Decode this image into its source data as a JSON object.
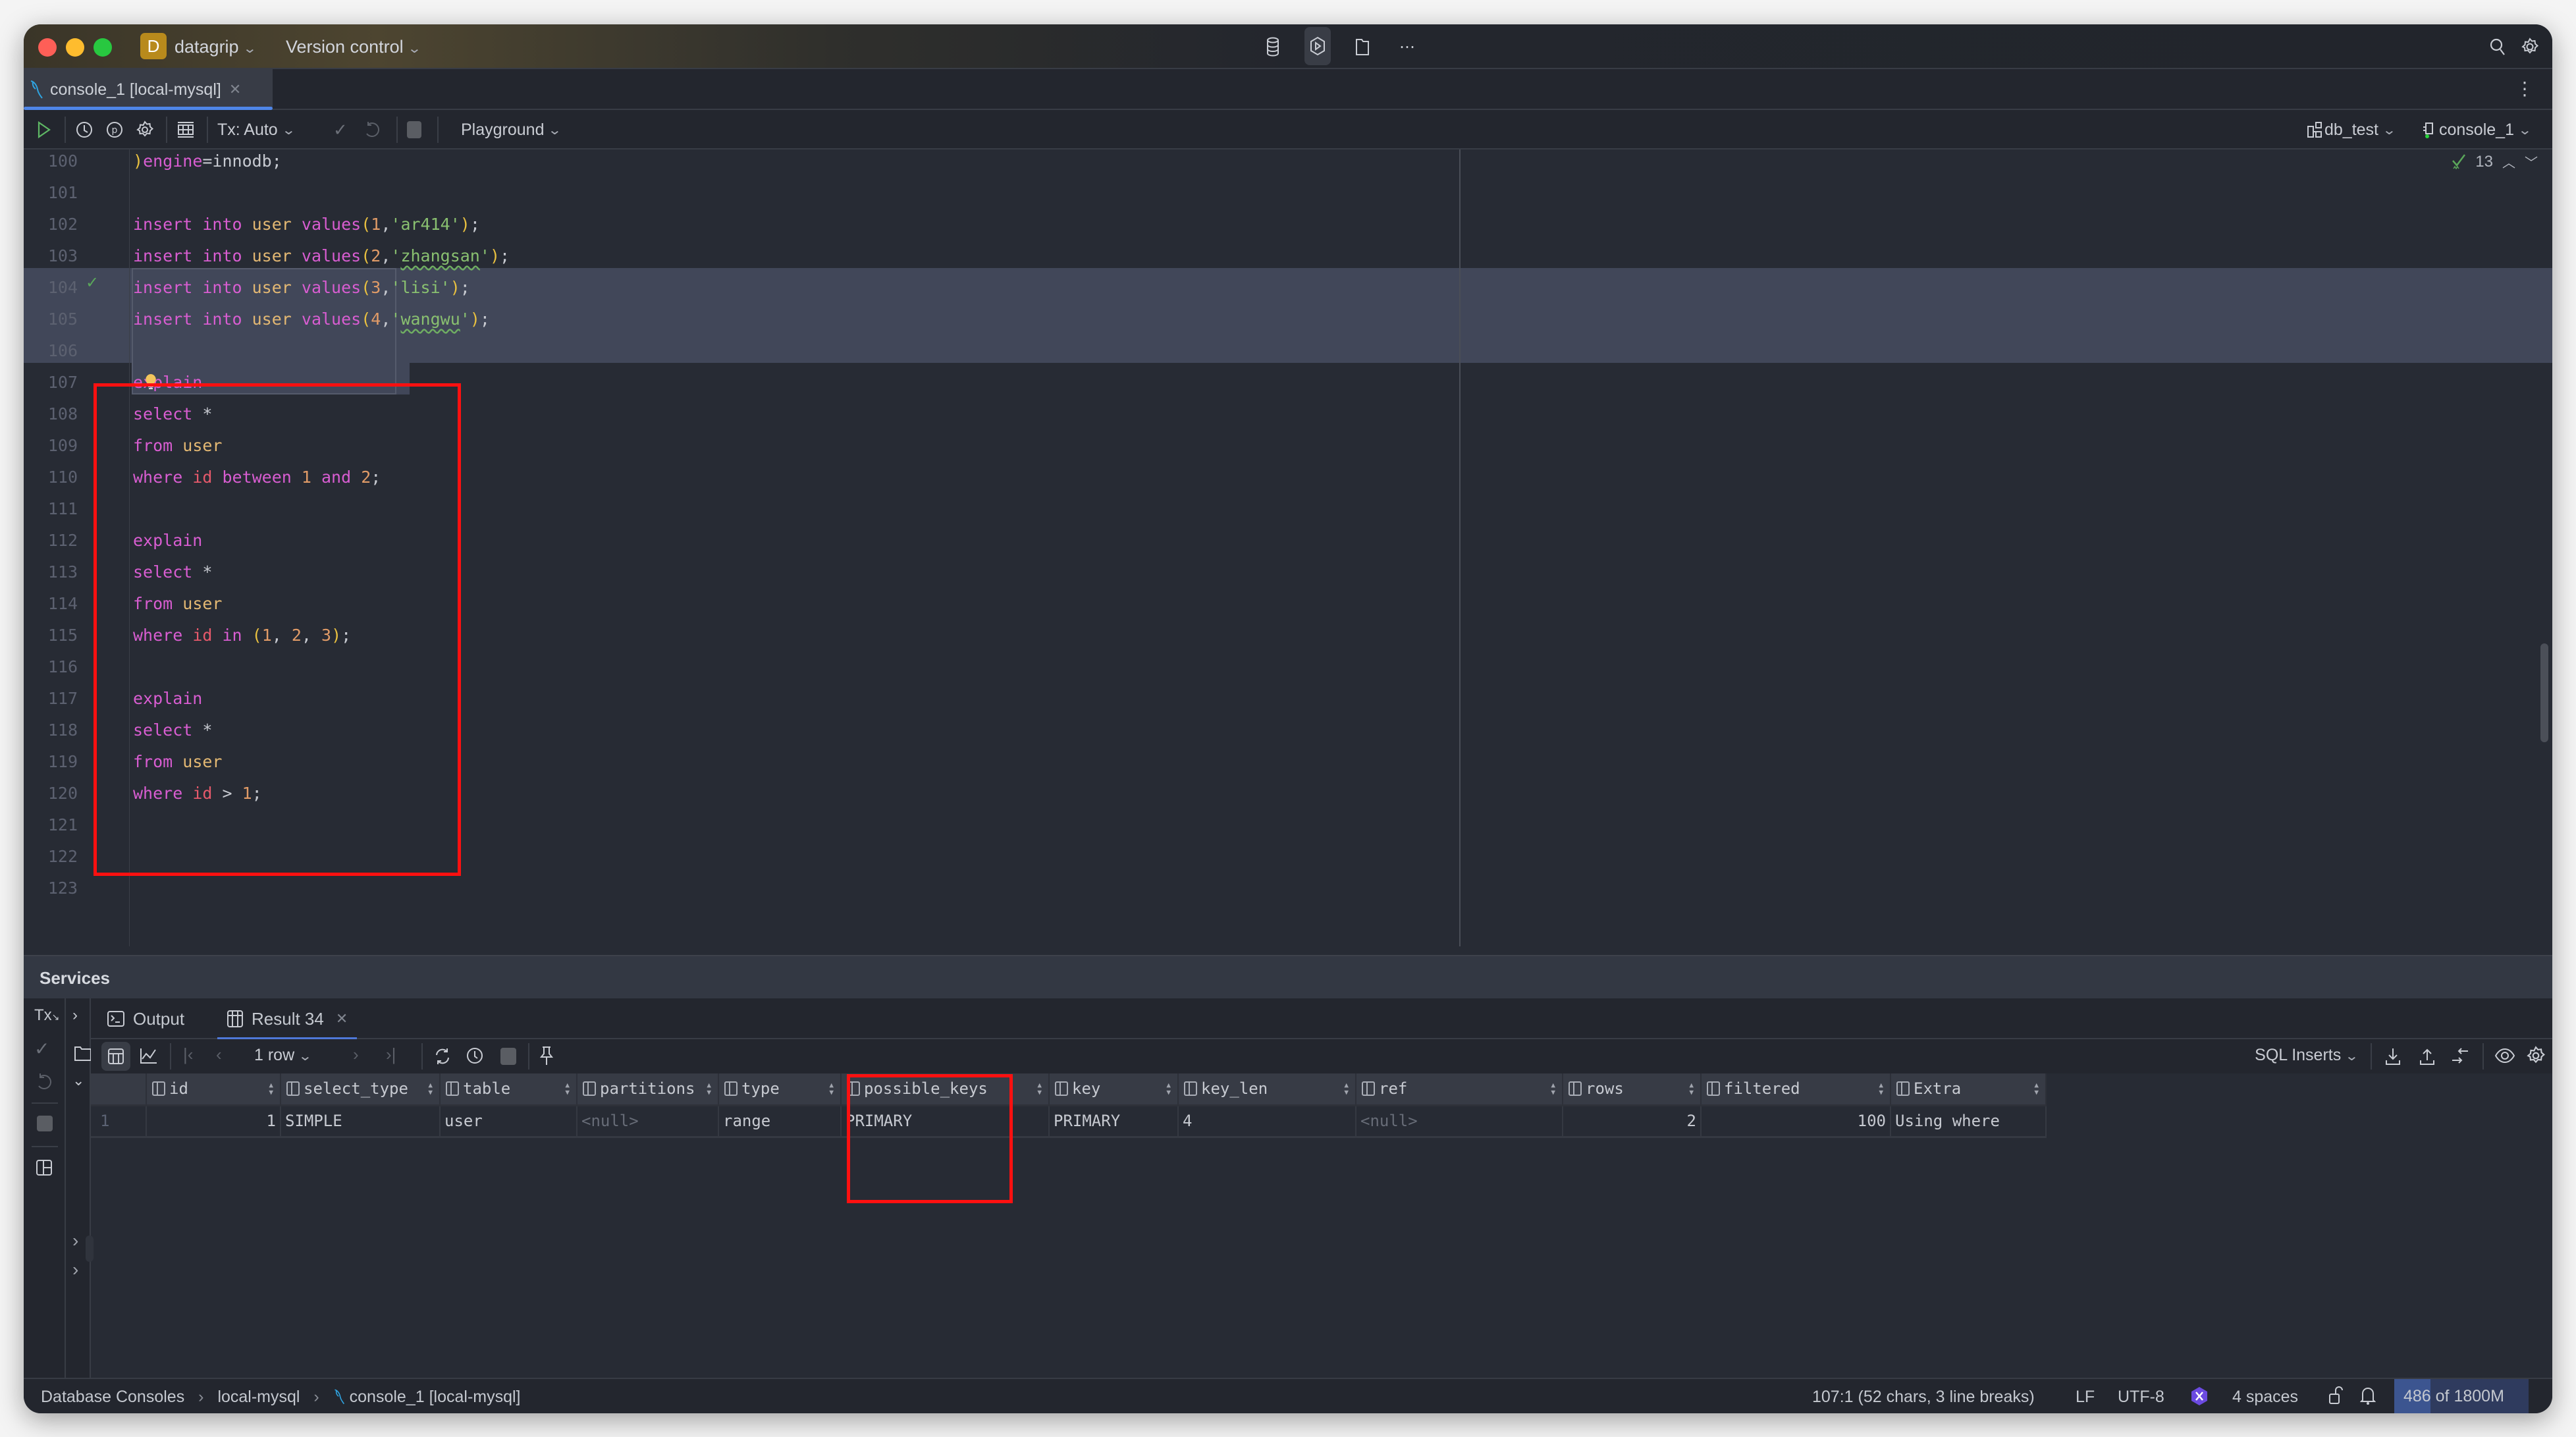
{
  "titlebar": {
    "project_badge": "D",
    "project_name": "datagrip",
    "vcs_label": "Version control",
    "center_icons": [
      "database-icon",
      "services-icon",
      "folder-icon",
      "more-icon"
    ],
    "right_icons": [
      "search-icon",
      "settings-icon"
    ]
  },
  "editor_tab": {
    "label": "console_1 [local-mysql]",
    "icon": "mysql-dolphin-icon"
  },
  "toolbar": {
    "tx_mode": "Tx: Auto",
    "playground": "Playground",
    "datasource": "db_test",
    "session": "console_1"
  },
  "editor": {
    "inspections_count": "13",
    "lines": [
      {
        "n": "100",
        "tokens": [
          [
            "paren",
            ")"
          ],
          [
            "kw",
            "engine"
          ],
          [
            "op",
            "=innodb;"
          ]
        ]
      },
      {
        "n": "101",
        "tokens": []
      },
      {
        "n": "102",
        "tokens": [
          [
            "kw",
            "insert into "
          ],
          [
            "tbl",
            "user "
          ],
          [
            "kw",
            "values"
          ],
          [
            "paren",
            "("
          ],
          [
            "num",
            "1"
          ],
          [
            "op",
            ","
          ],
          [
            "str",
            "'ar414'"
          ],
          [
            "paren",
            ")"
          ],
          [
            "op",
            ";"
          ]
        ]
      },
      {
        "n": "103",
        "tokens": [
          [
            "kw",
            "insert into "
          ],
          [
            "tbl",
            "user "
          ],
          [
            "kw",
            "values"
          ],
          [
            "paren",
            "("
          ],
          [
            "num",
            "2"
          ],
          [
            "op",
            ","
          ],
          [
            "str",
            "'"
          ],
          [
            "str squig",
            "zhangsan"
          ],
          [
            "str",
            "'"
          ],
          [
            "paren",
            ")"
          ],
          [
            "op",
            ";"
          ]
        ]
      },
      {
        "n": "104",
        "tokens": [
          [
            "kw",
            "insert into "
          ],
          [
            "tbl",
            "user "
          ],
          [
            "kw",
            "values"
          ],
          [
            "paren",
            "("
          ],
          [
            "num",
            "3"
          ],
          [
            "op",
            ","
          ],
          [
            "str",
            "'lisi'"
          ],
          [
            "paren",
            ")"
          ],
          [
            "op",
            ";"
          ]
        ]
      },
      {
        "n": "105",
        "tokens": [
          [
            "kw",
            "insert into "
          ],
          [
            "tbl",
            "user "
          ],
          [
            "kw",
            "values"
          ],
          [
            "paren",
            "("
          ],
          [
            "num",
            "4"
          ],
          [
            "op",
            ","
          ],
          [
            "str",
            "'"
          ],
          [
            "str squig",
            "wangwu"
          ],
          [
            "str",
            "'"
          ],
          [
            "paren",
            ")"
          ],
          [
            "op",
            ";"
          ]
        ]
      },
      {
        "n": "106",
        "tokens": []
      },
      {
        "n": "107",
        "tokens": [
          [
            "kw",
            "explain"
          ]
        ]
      },
      {
        "n": "108",
        "tokens": [
          [
            "kw",
            "select "
          ],
          [
            "op",
            "*"
          ]
        ]
      },
      {
        "n": "109",
        "tokens": [
          [
            "kw",
            "from "
          ],
          [
            "tbl",
            "user"
          ]
        ]
      },
      {
        "n": "110",
        "tokens": [
          [
            "kw",
            "where "
          ],
          [
            "idf",
            "id "
          ],
          [
            "kw",
            "between "
          ],
          [
            "num",
            "1 "
          ],
          [
            "kw",
            "and "
          ],
          [
            "num",
            "2"
          ],
          [
            "op",
            ";"
          ]
        ]
      },
      {
        "n": "111",
        "tokens": []
      },
      {
        "n": "112",
        "tokens": [
          [
            "kw",
            "explain"
          ]
        ]
      },
      {
        "n": "113",
        "tokens": [
          [
            "kw",
            "select "
          ],
          [
            "op",
            "*"
          ]
        ]
      },
      {
        "n": "114",
        "tokens": [
          [
            "kw",
            "from "
          ],
          [
            "tbl",
            "user"
          ]
        ]
      },
      {
        "n": "115",
        "tokens": [
          [
            "kw",
            "where "
          ],
          [
            "idf",
            "id "
          ],
          [
            "kw",
            "in "
          ],
          [
            "paren",
            "("
          ],
          [
            "num",
            "1"
          ],
          [
            "op",
            ", "
          ],
          [
            "num",
            "2"
          ],
          [
            "op",
            ", "
          ],
          [
            "num",
            "3"
          ],
          [
            "paren",
            ")"
          ],
          [
            "op",
            ";"
          ]
        ]
      },
      {
        "n": "116",
        "tokens": []
      },
      {
        "n": "117",
        "tokens": [
          [
            "kw",
            "explain"
          ]
        ]
      },
      {
        "n": "118",
        "tokens": [
          [
            "kw",
            "select "
          ],
          [
            "op",
            "*"
          ]
        ]
      },
      {
        "n": "119",
        "tokens": [
          [
            "kw",
            "from "
          ],
          [
            "tbl",
            "user"
          ]
        ]
      },
      {
        "n": "120",
        "tokens": [
          [
            "kw",
            "where "
          ],
          [
            "idf",
            "id "
          ],
          [
            "op",
            "> "
          ],
          [
            "num",
            "1"
          ],
          [
            "op",
            ";"
          ]
        ]
      },
      {
        "n": "121",
        "tokens": []
      },
      {
        "n": "122",
        "tokens": []
      },
      {
        "n": "123",
        "tokens": []
      }
    ]
  },
  "services": {
    "title": "Services",
    "tx_label": "Tx",
    "tabs": [
      {
        "label": "Output",
        "active": false
      },
      {
        "label": "Result 34",
        "active": true
      }
    ],
    "row_count": "1 row",
    "export_format": "SQL Inserts",
    "columns": [
      "id",
      "select_type",
      "table",
      "partitions",
      "type",
      "possible_keys",
      "key",
      "key_len",
      "ref",
      "rows",
      "filtered",
      "Extra"
    ],
    "rows": [
      {
        "row_number": "1",
        "cells": [
          "1",
          "SIMPLE",
          "user",
          "<null>",
          "range",
          "PRIMARY",
          "PRIMARY",
          "4",
          "<null>",
          "2",
          "100",
          "Using where"
        ]
      }
    ]
  },
  "statusbar": {
    "breadcrumb": [
      "Database Consoles",
      "local-mysql",
      "console_1 [local-mysql]"
    ],
    "caret": "107:1 (52 chars, 3 line breaks)",
    "line_ending": "LF",
    "encoding": "UTF-8",
    "indent": "4 spaces",
    "memory": "486 of 1800M",
    "memory_used_fraction": 0.27
  },
  "colors": {
    "accent": "#4f86e8",
    "annotation_red": "#ff1010",
    "keyword": "#d85dd1",
    "table": "#e3b873",
    "number": "#e09b67",
    "string": "#89c070"
  }
}
